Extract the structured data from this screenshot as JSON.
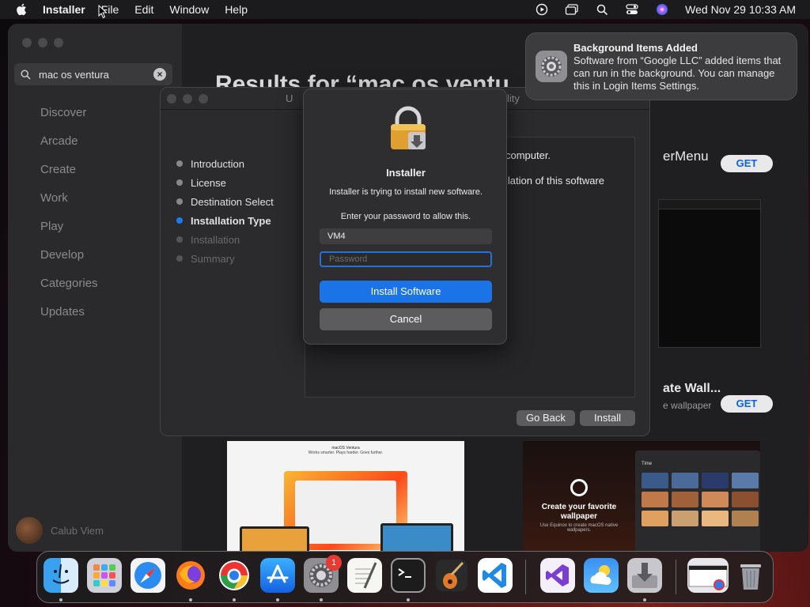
{
  "menubar": {
    "app": "Installer",
    "items": [
      "File",
      "Edit",
      "Window",
      "Help"
    ],
    "clock": "Wed Nov 29  10:33 AM"
  },
  "appstore": {
    "search_value": "mac os ventura",
    "nav": [
      "Discover",
      "Arcade",
      "Create",
      "Work",
      "Play",
      "Develop",
      "Categories",
      "Updates"
    ],
    "user": "Calub Viem",
    "results_title": "Results for “mac os ventu",
    "app1_name": "erMenu",
    "app2_name": "ate Wall...",
    "app2_sub": "e wallpaper",
    "get_label": "GET",
    "ventura_title": "macOS Ventura",
    "ventura_tagline": "Works smarter. Plays harder. Goes further.",
    "equinox_caption": "Create your favorite wallpaper",
    "equinox_sub": "Use Equinox to create macOS native wallpapers.",
    "equinox_panel_title": "Time"
  },
  "installer": {
    "title_fragment": "U",
    "title_fragment2": "lity",
    "steps": [
      {
        "label": "Introduction",
        "state": "done"
      },
      {
        "label": "License",
        "state": "done"
      },
      {
        "label": "Destination Select",
        "state": "done"
      },
      {
        "label": "Installation Type",
        "state": "active"
      },
      {
        "label": "Installation",
        "state": "pending"
      },
      {
        "label": "Summary",
        "state": "pending"
      }
    ],
    "text_line1": "computer.",
    "text_line2": "llation of this software",
    "go_back": "Go Back",
    "install": "Install"
  },
  "auth": {
    "title": "Installer",
    "message": "Installer is trying to install new software.",
    "prompt": "Enter your password to allow this.",
    "username": "VM4",
    "password_placeholder": "Password",
    "primary": "Install Software",
    "secondary": "Cancel"
  },
  "notification": {
    "title": "Background Items Added",
    "body": "Software from “Google LLC” added items that can run in the background. You can manage this in Login Items Settings."
  },
  "dock": {
    "settings_badge": "1"
  },
  "colors": {
    "accent": "#1a74e8",
    "active_step": "#1a7cf2",
    "badge": "#e8382f"
  }
}
